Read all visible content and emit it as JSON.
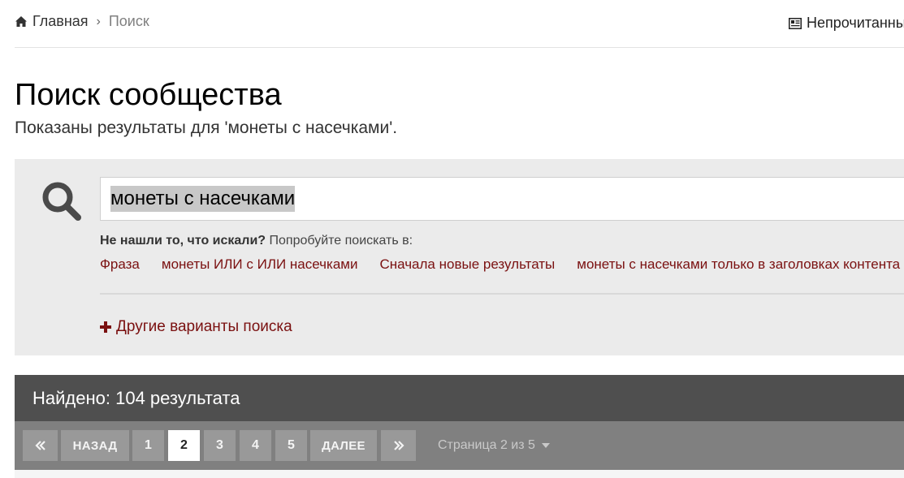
{
  "breadcrumb": {
    "home_label": "Главная",
    "current_label": "Поиск"
  },
  "header": {
    "unread_label": "Непрочитанные"
  },
  "page": {
    "title": "Поиск сообщества",
    "subtitle": "Показаны результаты для 'монеты с насечками'."
  },
  "search": {
    "query": "монеты с насечками",
    "hint_bold": "Не нашли то, что искали?",
    "hint_text": " Попробуйте поискать в:",
    "alternatives": [
      "Фраза",
      "монеты ИЛИ с ИЛИ насечками",
      "Сначала новые результаты",
      "монеты с насечками только в заголовках контента"
    ],
    "more_options_label": "Другие варианты поиска"
  },
  "results": {
    "summary": "Найдено: 104 результата"
  },
  "pagination": {
    "first_symbol": "«",
    "prev_label": "НАЗАД",
    "pages": [
      "1",
      "2",
      "3",
      "4",
      "5"
    ],
    "current_page": "2",
    "next_label": "ДАЛЕЕ",
    "last_symbol": "»",
    "page_info": "Страница 2 из 5"
  },
  "colors": {
    "link": "#7a1010",
    "panel_bg": "#ebebeb",
    "results_bar": "#4f4f4f",
    "pager_bg": "#808080",
    "pager_button": "#999999"
  },
  "icons": [
    "home-icon",
    "newspaper-icon",
    "search-icon",
    "plus-icon",
    "double-chevron-left-icon",
    "double-chevron-right-icon",
    "caret-down-icon"
  ]
}
